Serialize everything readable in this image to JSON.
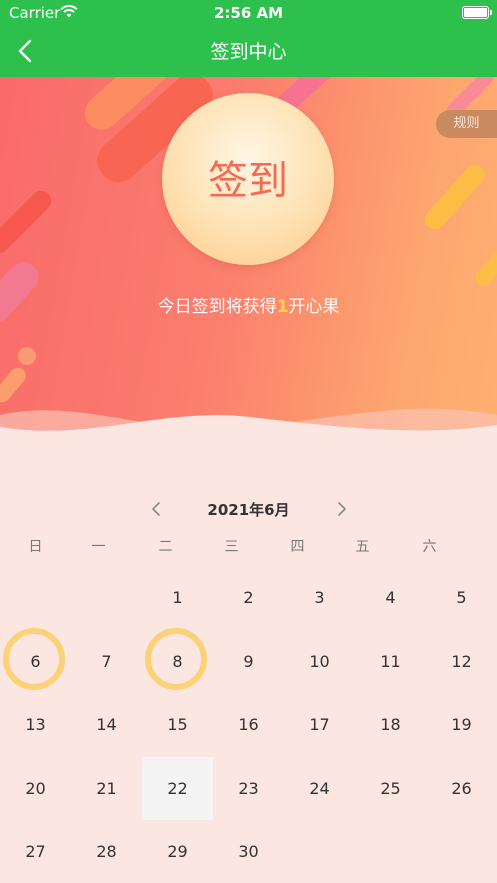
{
  "status_bar": {
    "carrier": "Carrier",
    "time": "2:56 AM"
  },
  "nav": {
    "title": "签到中心",
    "back_icon": "chevron-left-icon"
  },
  "banner": {
    "rules_label": "规则",
    "signin_label": "签到",
    "reward_prefix": "今日签到将获得",
    "reward_amount": "1",
    "reward_suffix": "开心果"
  },
  "calendar": {
    "month_label": "2021年6月",
    "prev_icon": "chevron-left-icon",
    "next_icon": "chevron-right-icon",
    "weekdays": [
      "日",
      "一",
      "二",
      "三",
      "四",
      "五",
      "六"
    ],
    "first_weekday_index": 2,
    "days": [
      "1",
      "2",
      "3",
      "4",
      "5",
      "6",
      "7",
      "8",
      "9",
      "10",
      "11",
      "12",
      "13",
      "14",
      "15",
      "16",
      "17",
      "18",
      "19",
      "20",
      "21",
      "22",
      "23",
      "24",
      "25",
      "26",
      "27",
      "28",
      "29",
      "30"
    ],
    "signed_days": [
      "6",
      "8"
    ],
    "today": "22"
  },
  "colors": {
    "nav_green": "#2dc04d",
    "sign_ring": "#fccf6e",
    "sign_text": "#f46a54",
    "reward_highlight": "#ffd34a"
  }
}
